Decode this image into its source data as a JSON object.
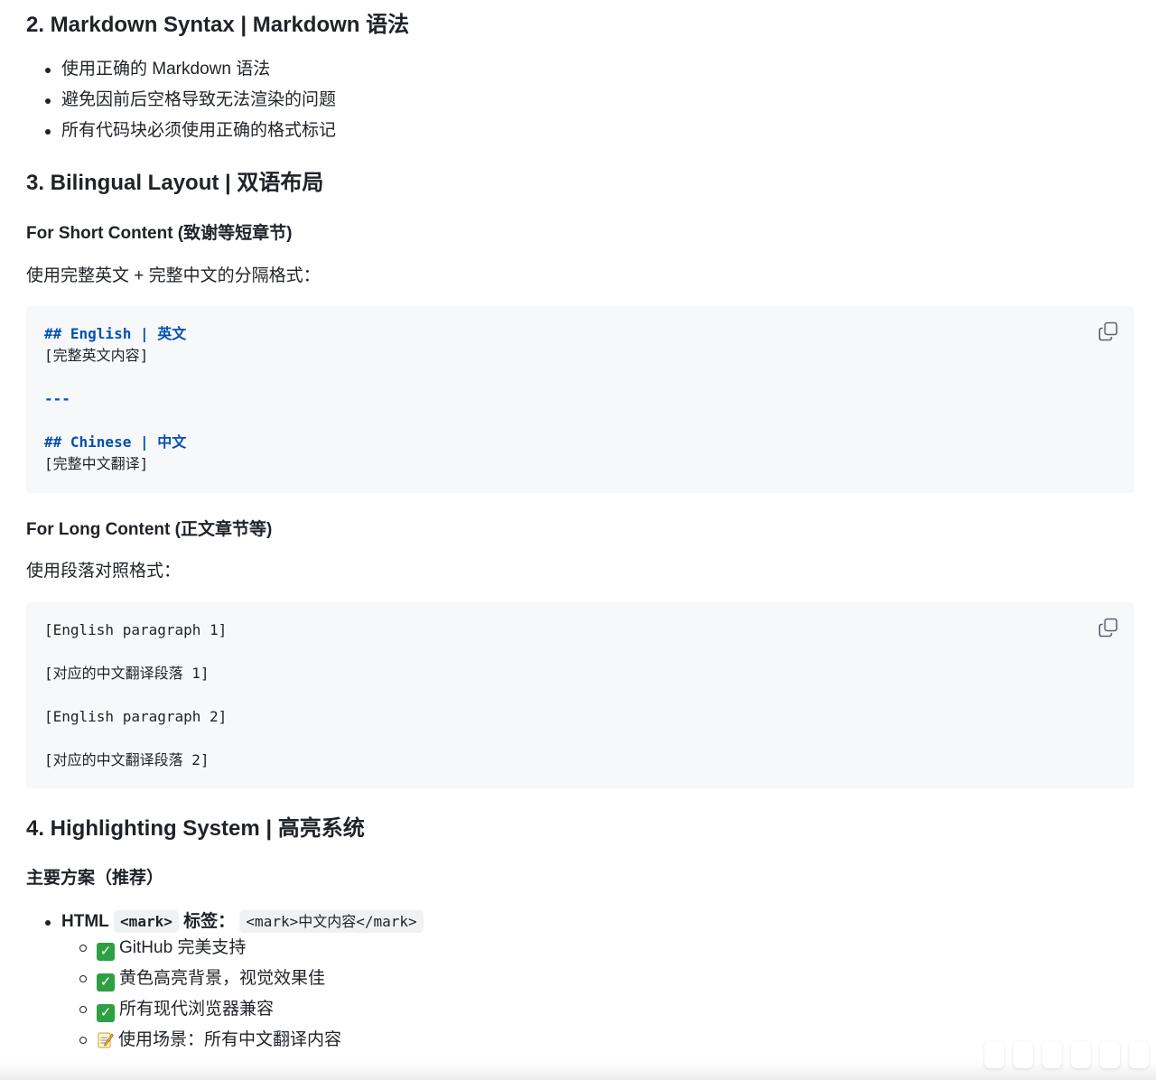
{
  "sections": {
    "s2": {
      "title": "2. Markdown Syntax | Markdown 语法",
      "bullets": [
        "使用正确的 Markdown 语法",
        "避免因前后空格导致无法渲染的问题",
        "所有代码块必须使用正确的格式标记"
      ]
    },
    "s3": {
      "title": "3. Bilingual Layout | 双语布局",
      "short": {
        "heading": "For Short Content (致谢等短章节)",
        "desc": "使用完整英文 + 完整中文的分隔格式：",
        "code": [
          "## English | 英文",
          "[完整英文内容]",
          "---",
          "## Chinese | 中文",
          "[完整中文翻译]"
        ]
      },
      "long": {
        "heading": "For Long Content (正文章节等)",
        "desc": "使用段落对照格式：",
        "code": [
          "[English paragraph 1]",
          "[对应的中文翻译段落 1]",
          "[English paragraph 2]",
          "[对应的中文翻译段落 2]"
        ]
      }
    },
    "s4": {
      "title": "4. Highlighting System | 高亮系统",
      "primary_heading": "主要方案（推荐）",
      "html_item": {
        "prefix": "HTML",
        "tag_code": "<mark>",
        "label": "标签：",
        "example_code": "<mark>中文内容</mark>"
      },
      "sub_items": [
        {
          "icon": "check-mark-icon",
          "text": "GitHub 完美支持"
        },
        {
          "icon": "check-mark-icon",
          "text": "黄色高亮背景，视觉效果佳"
        },
        {
          "icon": "check-mark-icon",
          "text": "所有现代浏览器兼容"
        },
        {
          "icon": "memo-icon",
          "text": "使用场景：所有中文翻译内容"
        }
      ]
    }
  },
  "colors": {
    "text": "#1f2328",
    "code_bg": "#f6f8fa",
    "code_heading": "#0550ae",
    "check_green": "#2ea043"
  }
}
